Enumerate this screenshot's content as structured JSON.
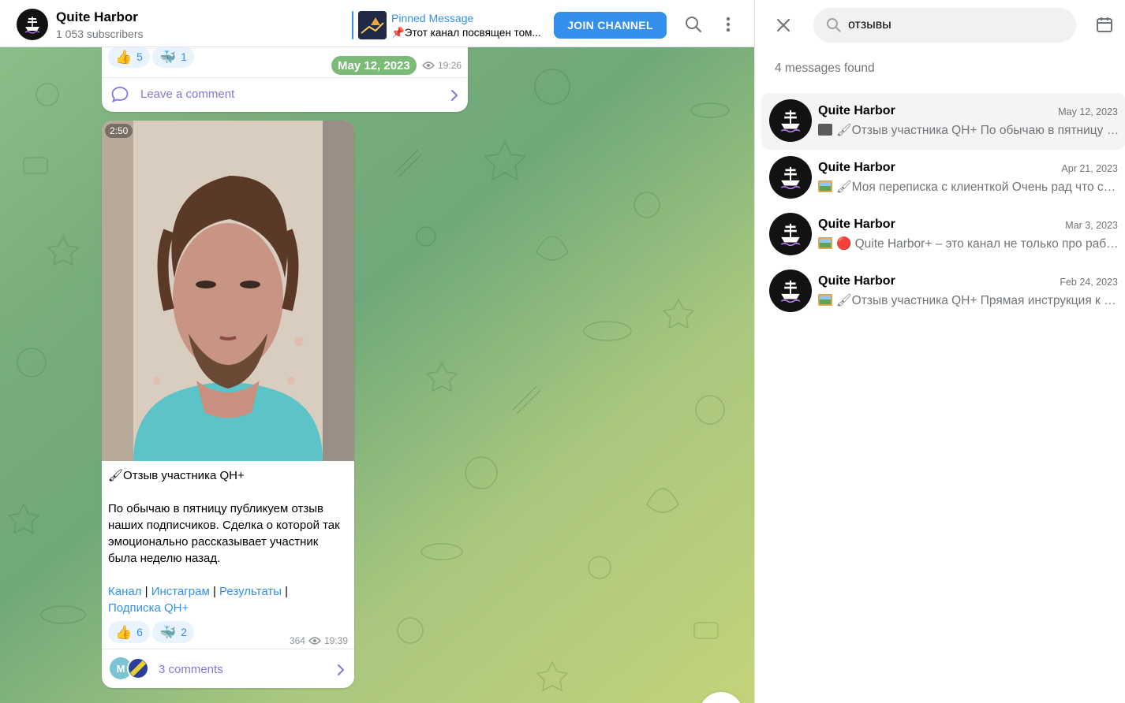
{
  "channel": {
    "title": "Quite Harbor",
    "subscribers": "1 053 subscribers"
  },
  "pinned": {
    "title": "Pinned Message",
    "text": "📌Этот канал посвящен том..."
  },
  "header": {
    "join_label": "JOIN CHANNEL"
  },
  "messages": {
    "first": {
      "reactions": [
        {
          "emoji": "👍",
          "count": "5"
        },
        {
          "emoji": "🐳",
          "count": "1"
        }
      ],
      "date_pill": "May 12, 2023",
      "time": "19:26",
      "comment_label": "Leave a comment"
    },
    "second": {
      "video_duration": "2:50",
      "title": "🖌Отзыв участника QH+",
      "body": "По обычаю в пятницу публикуем отзыв наших подписчиков. Сделка о которой так эмоционально рассказывает участник была неделю назад.",
      "links": {
        "channel": "Канал",
        "instagram": "Инстаграм",
        "results": "Результаты",
        "subscription": "Подписка QH+",
        "separator": " | "
      },
      "reactions": [
        {
          "emoji": "👍",
          "count": "6"
        },
        {
          "emoji": "🐳",
          "count": "2"
        }
      ],
      "views": "364",
      "time": "19:39",
      "commenter_initial": "M",
      "comment_label": "3 comments"
    }
  },
  "search": {
    "query": "отзывы",
    "results_count": "4 messages found",
    "results": [
      {
        "name": "Quite Harbor",
        "date": "May 12, 2023",
        "media": "video-icon",
        "text": "🖌Отзыв участника QH+ По обычаю в пятницу публикуем отзыв наших подписчиков."
      },
      {
        "name": "Quite Harbor",
        "date": "Apr 21, 2023",
        "media": "image-icon",
        "text": "🖌Моя переписка с клиенткой Очень рад что смог помочь"
      },
      {
        "name": "Quite Harbor",
        "date": "Mar 3, 2023",
        "media": "image-icon",
        "text": "🔴 Quite Harbor+ – это канал не только про работу"
      },
      {
        "name": "Quite Harbor",
        "date": "Feb 24, 2023",
        "media": "image-icon",
        "text": "🖌Отзыв участника QH+ Прямая инструкция к действию"
      }
    ]
  },
  "colors": {
    "accent": "#3390ec",
    "comment": "#8774e1",
    "chat_bg_from": "#8fc08a",
    "chat_bg_to": "#c3d379"
  }
}
